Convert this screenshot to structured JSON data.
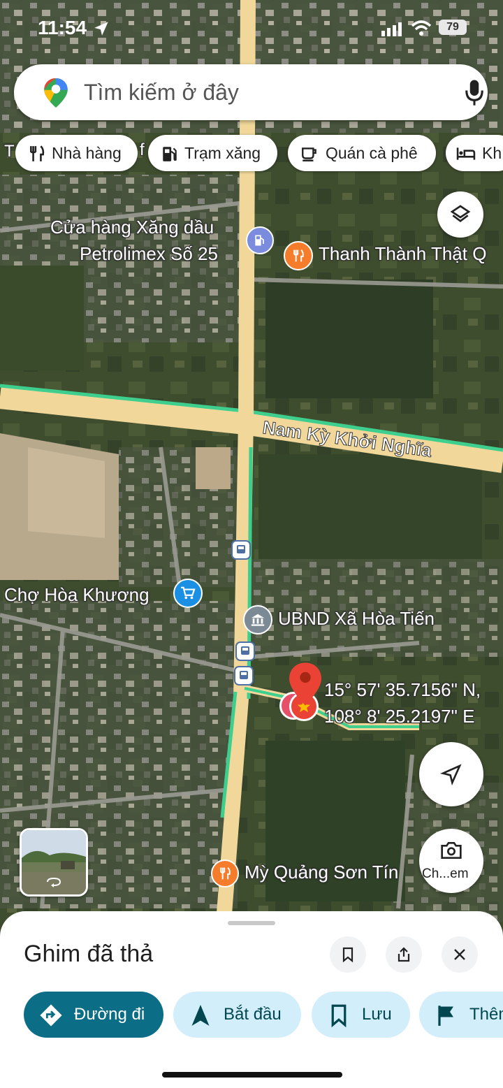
{
  "status_bar": {
    "time": "11:54",
    "battery": "79"
  },
  "search": {
    "placeholder": "Tìm kiếm ở đây"
  },
  "chips": [
    {
      "label": "Nhà hàng",
      "icon": "fork-knife-icon"
    },
    {
      "label": "Trạm xăng",
      "icon": "gas-station-icon"
    },
    {
      "label": "Quán cà phê",
      "icon": "coffee-cup-icon"
    },
    {
      "label": "Kh",
      "icon": "bed-icon"
    }
  ],
  "map": {
    "labels": {
      "fuel_line1": "Cửa hàng Xăng dầu",
      "fuel_line2": "Petrolimex Số 25",
      "thanh_thanh": "Thanh Thành Thật Q",
      "road": "Nam Kỳ Khởi Nghĩa",
      "market": "Chợ Hòa Khương",
      "ubnd": "UBND Xã Hòa Tiến",
      "coord_line1": "15° 57' 35.7156\" N,",
      "coord_line2": "108° 8' 25.2197\" E",
      "my_quang": "Mỳ Quảng Sơn Tín",
      "cut_left": "T",
      "cut_f": "f"
    },
    "camera_label": "Ch...em",
    "colors": {
      "road": "#f1d89a",
      "route": "#3ecf8e",
      "pin": "#ea4335",
      "accent": "#0b6e86"
    }
  },
  "sheet": {
    "title": "Ghim đã thả",
    "actions": [
      {
        "label": "Đường đi",
        "icon": "directions-icon"
      },
      {
        "label": "Bắt đầu",
        "icon": "navigation-arrow-icon"
      },
      {
        "label": "Lưu",
        "icon": "bookmark-icon"
      },
      {
        "label": "Thêm",
        "icon": "flag-icon"
      }
    ]
  }
}
